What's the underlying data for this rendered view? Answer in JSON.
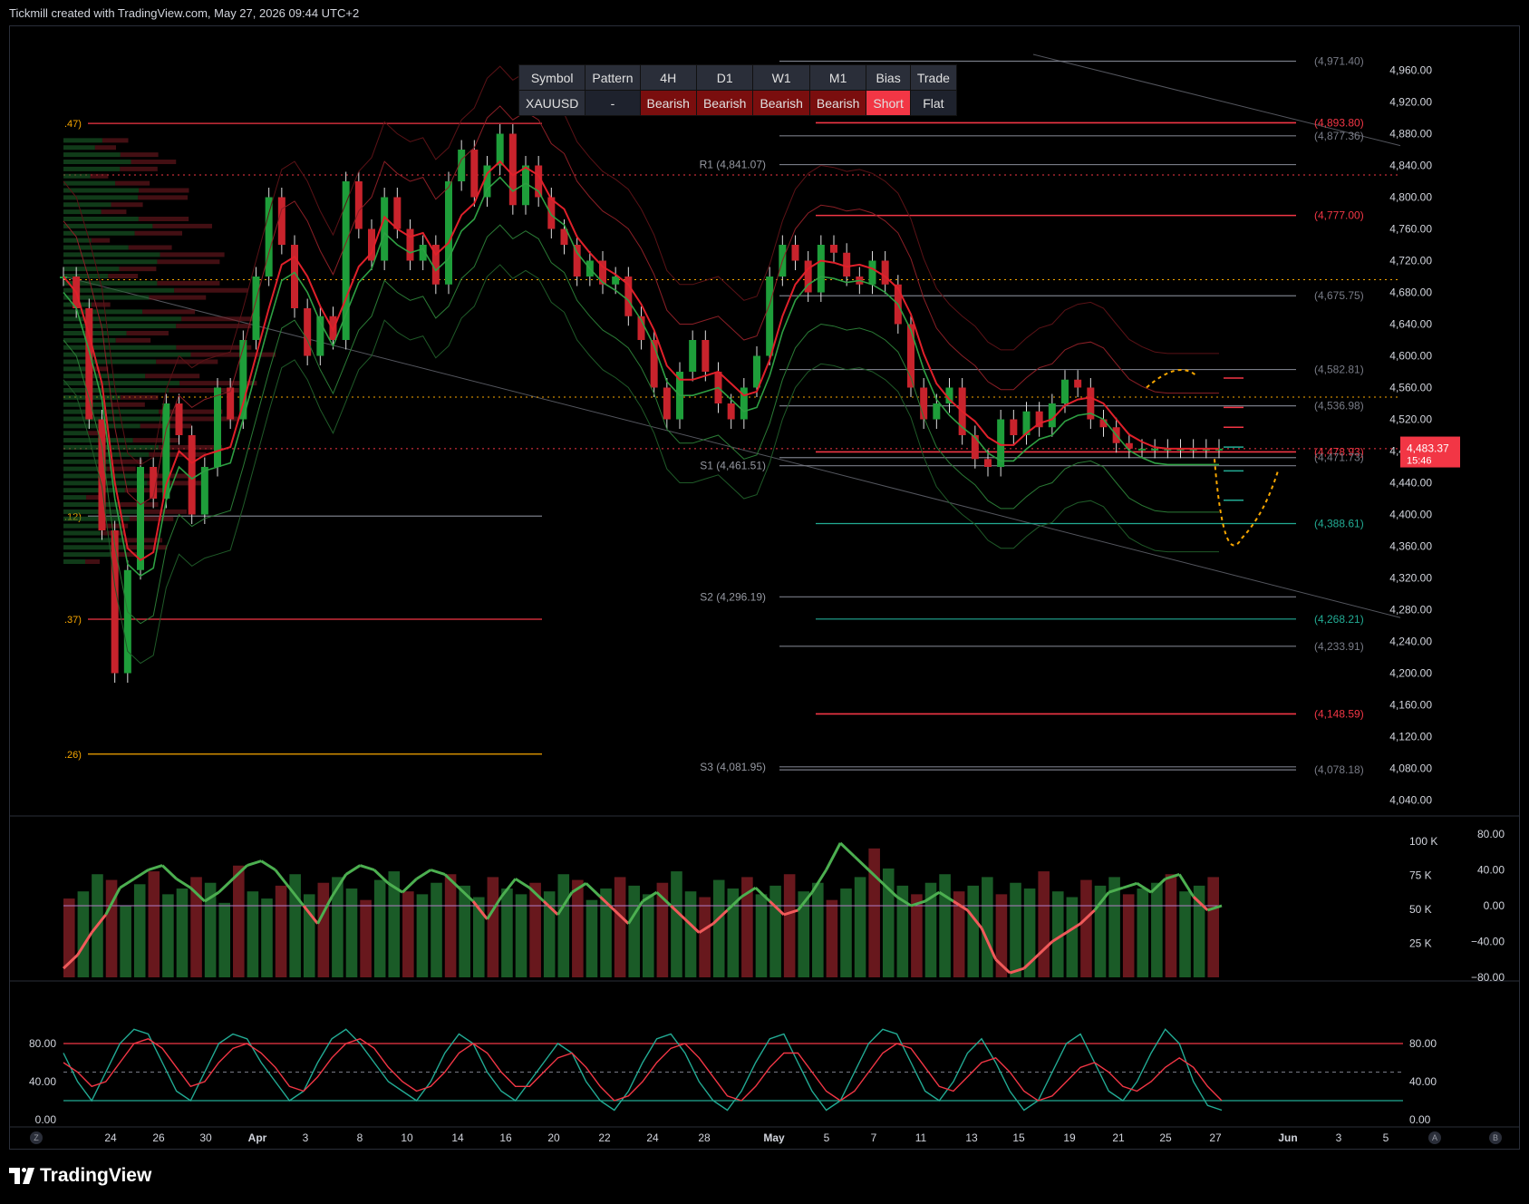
{
  "header": {
    "text": "Tickmill created with TradingView.com, May 27, 2026 09:44 UTC+2"
  },
  "brand": {
    "name": "TradingView"
  },
  "table": {
    "headers": [
      "Symbol",
      "Pattern",
      "4H",
      "D1",
      "W1",
      "M1",
      "Bias",
      "Trade"
    ],
    "values": [
      "XAUUSD",
      "-",
      "Bearish",
      "Bearish",
      "Bearish",
      "Bearish",
      "Short",
      "Flat"
    ]
  },
  "price_tag": {
    "price": "4,483.37",
    "timer": "15:46"
  },
  "colors": {
    "bull": "#1e9e3a",
    "bear": "#c8232c",
    "red_line": "#f23645",
    "green_line": "#22ab94",
    "orange": "#f7a600",
    "grey": "#787b86",
    "price_tag": "#f23645"
  },
  "chart_data": [
    {
      "type": "line",
      "title": "",
      "symbol": "XAUUSD",
      "ylim": [
        4020,
        4980
      ],
      "y_ticks": [
        "4,960.00",
        "4,920.00",
        "4,880.00",
        "4,840.00",
        "4,800.00",
        "4,760.00",
        "4,720.00",
        "4,680.00",
        "4,640.00",
        "4,600.00",
        "4,560.00",
        "4,520.00",
        "4,480.00",
        "4,440.00",
        "4,400.00",
        "4,360.00",
        "4,320.00",
        "4,280.00",
        "4,240.00",
        "4,200.00",
        "4,160.00",
        "4,120.00",
        "4,080.00",
        "4,040.00"
      ],
      "x_ticks": [
        "24",
        "26",
        "30",
        "Apr",
        "3",
        "8",
        "10",
        "14",
        "16",
        "20",
        "22",
        "24",
        "28",
        "May",
        "5",
        "7",
        "11",
        "13",
        "15",
        "19",
        "21",
        "25",
        "27",
        "Jun",
        "3",
        "5"
      ],
      "price_series": {
        "name": "XAUUSD",
        "x_index": [
          0,
          4,
          8,
          12,
          16,
          20,
          24,
          28,
          32,
          36,
          40,
          44,
          48,
          52,
          56,
          60,
          64,
          68,
          72,
          76,
          80,
          84,
          88,
          92,
          96,
          100,
          104,
          108,
          112,
          116,
          120,
          124,
          128,
          132,
          136,
          140,
          144,
          148,
          152,
          156,
          160,
          164,
          168,
          172,
          176,
          180,
          184,
          188,
          192,
          196,
          200,
          204,
          208,
          212,
          216,
          220,
          224,
          228,
          232,
          236,
          240,
          244,
          248,
          252,
          256,
          260,
          264,
          268,
          272,
          276,
          280,
          284,
          288,
          292,
          296,
          300,
          304,
          308,
          312,
          316,
          320,
          324,
          328,
          332,
          336,
          340,
          344,
          348,
          352,
          356,
          360
        ],
        "close": [
          4700,
          4660,
          4520,
          4380,
          4200,
          4330,
          4460,
          4420,
          4540,
          4500,
          4400,
          4460,
          4560,
          4520,
          4620,
          4700,
          4800,
          4740,
          4660,
          4600,
          4650,
          4620,
          4820,
          4760,
          4720,
          4800,
          4760,
          4720,
          4740,
          4690,
          4820,
          4860,
          4800,
          4840,
          4880,
          4790,
          4840,
          4800,
          4760,
          4740,
          4700,
          4720,
          4690,
          4700,
          4650,
          4620,
          4560,
          4520,
          4580,
          4620,
          4580,
          4540,
          4520,
          4560,
          4600,
          4700,
          4740,
          4720,
          4680,
          4740,
          4730,
          4700,
          4690,
          4720,
          4690,
          4640,
          4560,
          4520,
          4540,
          4560,
          4500,
          4470,
          4460,
          4520,
          4500,
          4530,
          4510,
          4540,
          4570,
          4560,
          4520,
          4510,
          4490,
          4483,
          4483,
          4483,
          4483,
          4483,
          4483,
          4483,
          4483
        ]
      },
      "levels": [
        {
          "label": "(4,971.40)",
          "value": 4971.4,
          "color": "grey"
        },
        {
          "label": "(4,893.80)",
          "value": 4893.8,
          "color": "red"
        },
        {
          "label": "(4,877.36)",
          "value": 4877.36,
          "color": "grey"
        },
        {
          "label": "R1 (4,841.07)",
          "value": 4841.07,
          "color": "grey"
        },
        {
          "label": "(4,777.00)",
          "value": 4777.0,
          "color": "red"
        },
        {
          "label": "(4,675.75)",
          "value": 4675.75,
          "color": "grey"
        },
        {
          "label": "(4,582.81)",
          "value": 4582.81,
          "color": "grey"
        },
        {
          "label": "(4,536.98)",
          "value": 4536.98,
          "color": "grey"
        },
        {
          "label": "(4,478.93)",
          "value": 4478.93,
          "color": "red"
        },
        {
          "label": "(4,471.73)",
          "value": 4471.73,
          "color": "grey"
        },
        {
          "label": "S1 (4,461.51)",
          "value": 4461.51,
          "color": "grey"
        },
        {
          "label": "(4,388.61)",
          "value": 4388.61,
          "color": "green"
        },
        {
          "label": "S2 (4,296.19)",
          "value": 4296.19,
          "color": "grey"
        },
        {
          "label": "(4,268.21)",
          "value": 4268.21,
          "color": "green"
        },
        {
          "label": "(4,233.91)",
          "value": 4233.91,
          "color": "grey"
        },
        {
          "label": "(4,148.59)",
          "value": 4148.59,
          "color": "red"
        },
        {
          "label": "S3 (4,081.95)",
          "value": 4081.95,
          "color": "grey"
        },
        {
          "label": "(4,078.18)",
          "value": 4078.18,
          "color": "grey"
        }
      ],
      "left_labels": [
        ".47)",
        ".12)",
        ".37)",
        ".26)"
      ]
    },
    {
      "type": "bar",
      "title": "",
      "y_ticks_left": [
        "100 K",
        "75 K",
        "50 K",
        "25 K"
      ],
      "y_ticks_right": [
        "80.00",
        "40.00",
        "0.00",
        "−40.00",
        "−80.00"
      ],
      "volume": [
        55,
        60,
        72,
        68,
        50,
        65,
        74,
        58,
        62,
        70,
        66,
        52,
        78,
        60,
        55,
        64,
        72,
        58,
        66,
        70,
        62,
        54,
        68,
        74,
        60,
        58,
        66,
        72,
        64,
        56,
        70,
        62,
        58,
        66,
        60,
        72,
        68,
        54,
        62,
        70,
        64,
        58,
        66,
        74,
        60,
        56,
        68,
        62,
        70,
        58,
        64,
        72,
        60,
        66,
        54,
        62,
        70,
        90,
        76,
        64,
        58,
        66,
        72,
        60,
        64,
        70,
        58,
        66,
        62,
        74,
        60,
        56,
        68,
        64,
        70,
        58,
        62,
        66,
        72,
        60,
        64,
        70
      ],
      "oscillator": [
        -70,
        -55,
        -30,
        -10,
        20,
        30,
        40,
        45,
        30,
        20,
        5,
        15,
        30,
        45,
        50,
        40,
        20,
        0,
        -20,
        10,
        35,
        45,
        40,
        25,
        15,
        30,
        40,
        35,
        20,
        5,
        -15,
        10,
        30,
        20,
        5,
        -10,
        15,
        25,
        10,
        -5,
        -20,
        5,
        15,
        0,
        -15,
        -30,
        -20,
        -5,
        10,
        20,
        5,
        -10,
        -5,
        15,
        40,
        70,
        55,
        40,
        25,
        10,
        0,
        5,
        15,
        5,
        -5,
        -25,
        -60,
        -75,
        -70,
        -55,
        -40,
        -30,
        -20,
        -5,
        15,
        20,
        25,
        15,
        30,
        35,
        10,
        -5,
        0
      ],
      "ylim": [
        -80,
        80
      ]
    },
    {
      "type": "line",
      "title": "",
      "y_ticks": [
        "80.00",
        "40.00",
        "0.00"
      ],
      "ylim": [
        0,
        100
      ],
      "series": [
        {
          "color": "green",
          "values": [
            70,
            40,
            20,
            50,
            80,
            95,
            90,
            60,
            30,
            20,
            50,
            80,
            90,
            85,
            60,
            40,
            20,
            30,
            60,
            85,
            95,
            80,
            60,
            40,
            30,
            20,
            40,
            70,
            90,
            80,
            50,
            30,
            20,
            40,
            60,
            80,
            70,
            40,
            20,
            10,
            30,
            60,
            85,
            90,
            70,
            40,
            20,
            10,
            30,
            60,
            85,
            90,
            60,
            30,
            10,
            20,
            50,
            80,
            95,
            90,
            60,
            30,
            20,
            40,
            70,
            85,
            60,
            30,
            10,
            20,
            50,
            80,
            90,
            60,
            30,
            20,
            40,
            70,
            95,
            80,
            40,
            15,
            10
          ]
        },
        {
          "color": "red",
          "values": [
            60,
            50,
            35,
            40,
            60,
            80,
            85,
            75,
            55,
            35,
            40,
            60,
            75,
            80,
            70,
            55,
            35,
            30,
            45,
            65,
            80,
            85,
            75,
            55,
            40,
            30,
            35,
            50,
            70,
            80,
            70,
            50,
            35,
            35,
            50,
            65,
            70,
            55,
            35,
            20,
            25,
            40,
            60,
            75,
            80,
            65,
            45,
            25,
            20,
            35,
            55,
            70,
            70,
            50,
            30,
            20,
            30,
            50,
            70,
            80,
            75,
            55,
            35,
            30,
            45,
            60,
            65,
            50,
            30,
            20,
            25,
            40,
            55,
            60,
            50,
            35,
            30,
            40,
            55,
            65,
            55,
            35,
            20
          ]
        }
      ]
    }
  ]
}
